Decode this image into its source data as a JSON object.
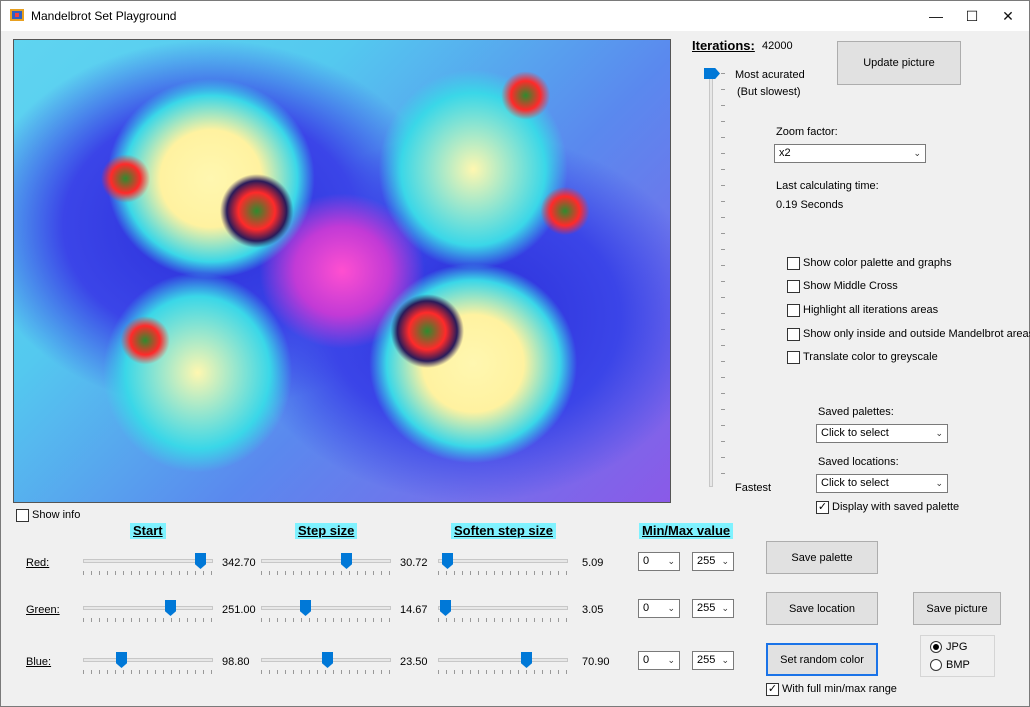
{
  "window": {
    "title": "Mandelbrot Set Playground",
    "minimize": "—",
    "maximize": "☐",
    "close": "✕"
  },
  "iterations": {
    "label": "Iterations:",
    "value": "42000",
    "most_accurate": "Most acurated",
    "but_slowest": "(But slowest)",
    "fastest": "Fastest"
  },
  "update_button": "Update picture",
  "zoom": {
    "label": "Zoom factor:",
    "value": "x2"
  },
  "calc": {
    "label": "Last calculating time:",
    "value": "0.19 Seconds"
  },
  "options": [
    {
      "label": "Show color palette and graphs",
      "checked": false
    },
    {
      "label": "Show Middle Cross",
      "checked": false
    },
    {
      "label": "Highlight all iterations areas",
      "checked": false
    },
    {
      "label": "Show only inside and outside Mandelbrot areas",
      "checked": false
    },
    {
      "label": "Translate color to greyscale",
      "checked": false
    }
  ],
  "saved_palettes": {
    "label": "Saved palettes:",
    "value": "Click to select"
  },
  "saved_locations": {
    "label": "Saved locations:",
    "value": "Click to select"
  },
  "display_saved_palette": {
    "label": "Display with saved palette",
    "checked": true
  },
  "show_info": {
    "label": "Show info",
    "checked": false
  },
  "headers": {
    "start": "Start",
    "step": "Step size",
    "soften": "Soften step size",
    "minmax": "Min/Max value"
  },
  "rows": [
    {
      "label": "Red:",
      "start": "342.70",
      "step": "30.72",
      "soften": "5.09",
      "min": "0",
      "max": "255",
      "start_level": 0.94,
      "step_level": 0.67,
      "soften_level": 0.03
    },
    {
      "label": "Green:",
      "start": "251.00",
      "step": "14.67",
      "soften": "3.05",
      "min": "0",
      "max": "255",
      "start_level": 0.69,
      "step_level": 0.33,
      "soften_level": 0.02
    },
    {
      "label": "Blue:",
      "start": "98.80",
      "step": "23.50",
      "soften": "70.90",
      "min": "0",
      "max": "255",
      "start_level": 0.28,
      "step_level": 0.51,
      "soften_level": 0.7
    }
  ],
  "buttons": {
    "save_palette": "Save  palette",
    "save_location": "Save location",
    "save_picture": "Save picture",
    "random_color": "Set random color"
  },
  "format": {
    "jpg": "JPG",
    "bmp": "BMP",
    "selected": "JPG"
  },
  "full_range": {
    "label": "With full min/max range",
    "checked": true
  },
  "dropdown_arrow": "⌄",
  "checkmark": "✓"
}
